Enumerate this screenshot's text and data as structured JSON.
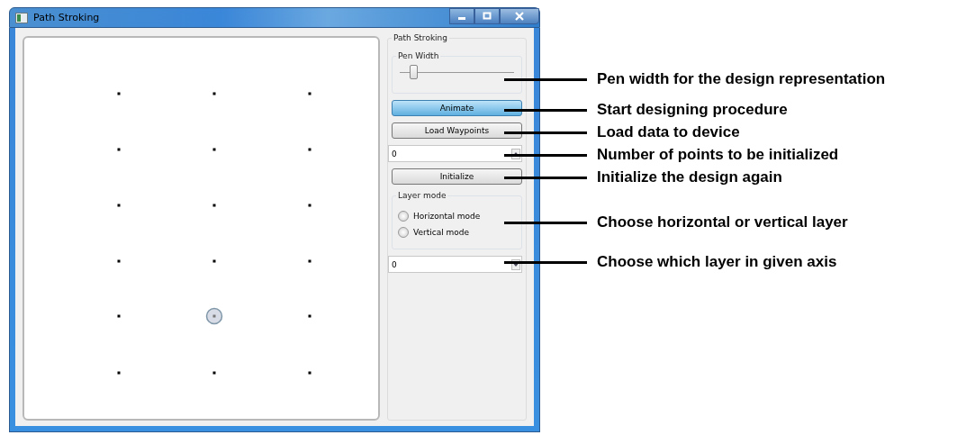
{
  "window": {
    "title": "Path Stroking"
  },
  "panel": {
    "title": "Path Stroking",
    "pen_width": {
      "title": "Pen Width",
      "level": 0.12
    },
    "controls": [
      {
        "kind": "button",
        "label": "Animate",
        "selected": true
      },
      {
        "kind": "button",
        "label": "Load Waypoints",
        "selected": false
      },
      {
        "kind": "spinbox",
        "value": "0"
      },
      {
        "kind": "button",
        "label": "Initialize",
        "selected": false
      }
    ],
    "layer_mode": {
      "title": "Layer mode",
      "options": [
        {
          "label": "Horizontal mode",
          "selected": false
        },
        {
          "label": "Vertical mode",
          "selected": false
        }
      ]
    },
    "layer_spinbox": {
      "value": "0"
    }
  },
  "annotations": [
    "Pen width for the design representation",
    "Start designing procedure",
    "Load data to device",
    "Number of points to be initialized",
    "Initialize the design again",
    "Choose horizontal or vertical layer",
    "Choose which layer in given axis"
  ]
}
